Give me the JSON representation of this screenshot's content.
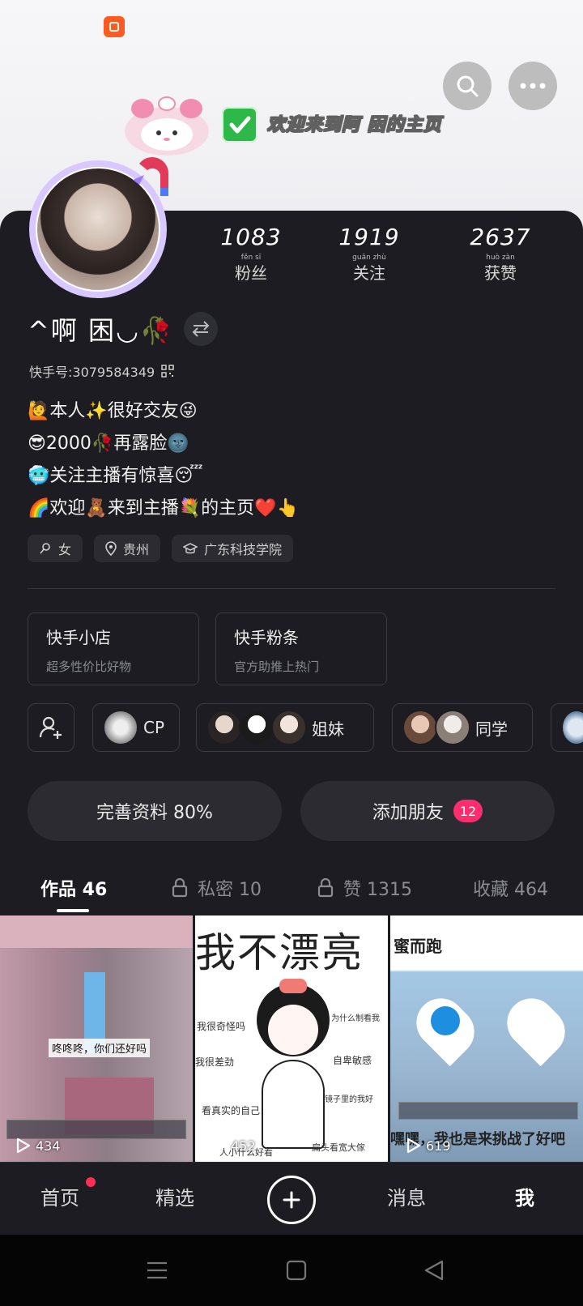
{
  "header": {
    "welcome": "欢迎来到阿 困的主页"
  },
  "stats": [
    {
      "value": "1083",
      "label": "粉丝",
      "pinyin": "fěn sī"
    },
    {
      "value": "1919",
      "label": "关注",
      "pinyin": "guān zhù"
    },
    {
      "value": "2637",
      "label": "获赞",
      "pinyin": "huò zàn"
    }
  ],
  "profile": {
    "name": "^啊 困◡🥀",
    "uid": "快手号:3079584349",
    "bio": [
      "🙋本人✨很好交友😜",
      "😎2000🥀再露脸🌚",
      "🥶关注主播有惊喜😴",
      "🌈欢迎🧸来到主播💐的主页❤️👆"
    ],
    "tags": [
      "女",
      "贵州",
      "广东科技学院"
    ]
  },
  "cards": [
    {
      "title": "快手小店",
      "subtitle": "超多性价比好物"
    },
    {
      "title": "快手粉条",
      "subtitle": "官方助推上热门"
    }
  ],
  "relations": [
    {
      "label": "CP"
    },
    {
      "label": "姐妹"
    },
    {
      "label": "同学"
    }
  ],
  "actions": {
    "complete_profile": "完善资料 80%",
    "add_friends": "添加朋友",
    "friend_badge": "12"
  },
  "tabs": [
    {
      "label": "作品 46"
    },
    {
      "label": "私密 10"
    },
    {
      "label": "赞 1315"
    },
    {
      "label": "收藏 464"
    }
  ],
  "videos": [
    {
      "count": "434",
      "caption": "咚咚咚，你们还好吗"
    },
    {
      "count": "452",
      "caption": "我不漂亮"
    },
    {
      "count": "619",
      "title": "蜜而跑",
      "caption": "嘿嘿，我也是来挑战了好吧"
    }
  ],
  "video2_scribbles": [
    "我很奇怪吗",
    "为什么制看我",
    "我很差劲",
    "自卑敏感",
    "看真实的自己",
    "镜子里的我好",
    "扁头看宽大傢",
    "人小什么好看"
  ],
  "bottom_nav": {
    "home": "首页",
    "featured": "精选",
    "messages": "消息",
    "me": "我"
  },
  "colors": {
    "panel": "#1c1c22",
    "badge": "#ff2d6e",
    "logo": "#ff5a1f",
    "check": "#2fb84a"
  }
}
